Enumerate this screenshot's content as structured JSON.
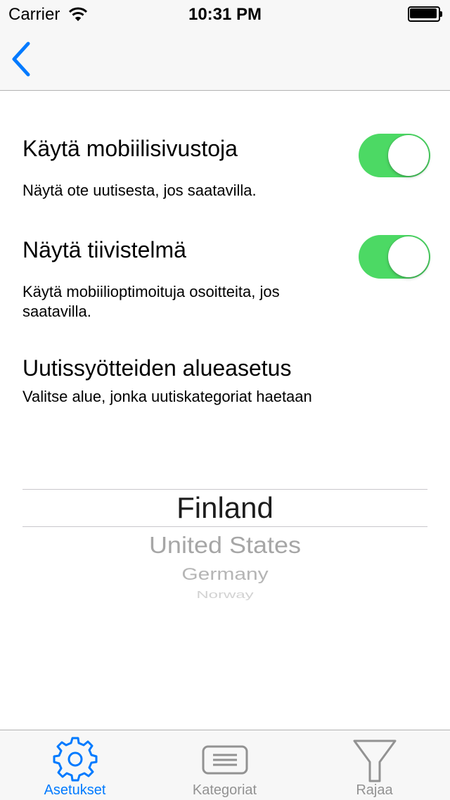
{
  "status_bar": {
    "carrier": "Carrier",
    "time": "10:31 PM",
    "icons": [
      "wifi-icon",
      "battery-icon"
    ]
  },
  "nav_bar": {
    "back_icon": "chevron-left-icon",
    "accent_color": "#007aff"
  },
  "settings": [
    {
      "title": "Käytä mobiilisivustoja",
      "description": "Näytä ote uutisesta, jos saatavilla.",
      "toggle_on": true
    },
    {
      "title": "Näytä tiivistelmä",
      "description": "Käytä mobiilioptimoituja osoitteita, jos saatavilla.",
      "toggle_on": true
    },
    {
      "title": "Uutissyötteiden alueasetus",
      "description": "Valitse alue, jonka uutiskategoriat haetaan"
    }
  ],
  "toggle_color": "#4cd964",
  "region_picker": {
    "selected": "Finland",
    "options": [
      "Finland",
      "United States",
      "Germany",
      "Norway"
    ]
  },
  "tab_bar": {
    "tabs": [
      {
        "label": "Asetukset",
        "icon": "gear-icon",
        "active": true
      },
      {
        "label": "Kategoriat",
        "icon": "list-icon",
        "active": false
      },
      {
        "label": "Rajaa",
        "icon": "filter-icon",
        "active": false
      }
    ],
    "active_color": "#007aff",
    "inactive_color": "#929292"
  }
}
